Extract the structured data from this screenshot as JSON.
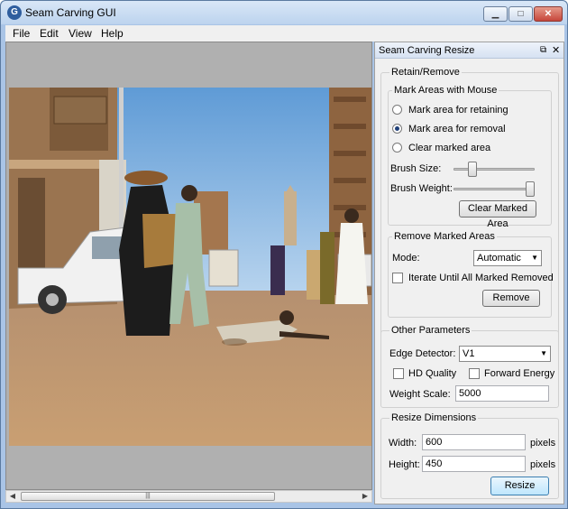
{
  "window": {
    "title": "Seam Carving GUI",
    "minimize_glyph": "▁",
    "maximize_glyph": "□",
    "close_glyph": "✕",
    "app_icon_glyph": "G"
  },
  "menu": {
    "items": [
      "File",
      "Edit",
      "View",
      "Help"
    ]
  },
  "scrollbar": {
    "left_arrow": "◀",
    "right_arrow": "▶",
    "grip": "|||"
  },
  "panel": {
    "title": "Seam Carving Resize",
    "float_glyph": "⧉",
    "close_glyph": "✕",
    "retain_remove": {
      "title": "Retain/Remove",
      "mark": {
        "title": "Mark Areas with Mouse",
        "options": [
          "Mark area for retaining",
          "Mark area for removal",
          "Clear marked area"
        ],
        "selected_index": 1,
        "brush_size_label": "Brush Size:",
        "brush_size_level": 0.2,
        "brush_weight_label": "Brush Weight:",
        "brush_weight_level": 1.0,
        "clear_button": "Clear Marked Area"
      },
      "remove": {
        "title": "Remove Marked Areas",
        "mode_label": "Mode:",
        "mode_value": "Automatic",
        "iterate_label": "Iterate Until All Marked Removed",
        "iterate_checked": false,
        "remove_button": "Remove"
      }
    },
    "other": {
      "title": "Other Parameters",
      "edge_label": "Edge Detector:",
      "edge_value": "V1",
      "hd_label": "HD Quality",
      "hd_checked": false,
      "forward_label": "Forward Energy",
      "forward_checked": false,
      "weight_label": "Weight Scale:",
      "weight_value": "5000"
    },
    "resize": {
      "title": "Resize Dimensions",
      "width_label": "Width:",
      "width_value": "600",
      "height_label": "Height:",
      "height_value": "450",
      "unit": "pixels",
      "resize_button": "Resize"
    }
  },
  "colors": {
    "sky": "#7fb2e0",
    "ground": "#c79b6e",
    "window_frame": "#a9c4e6"
  }
}
